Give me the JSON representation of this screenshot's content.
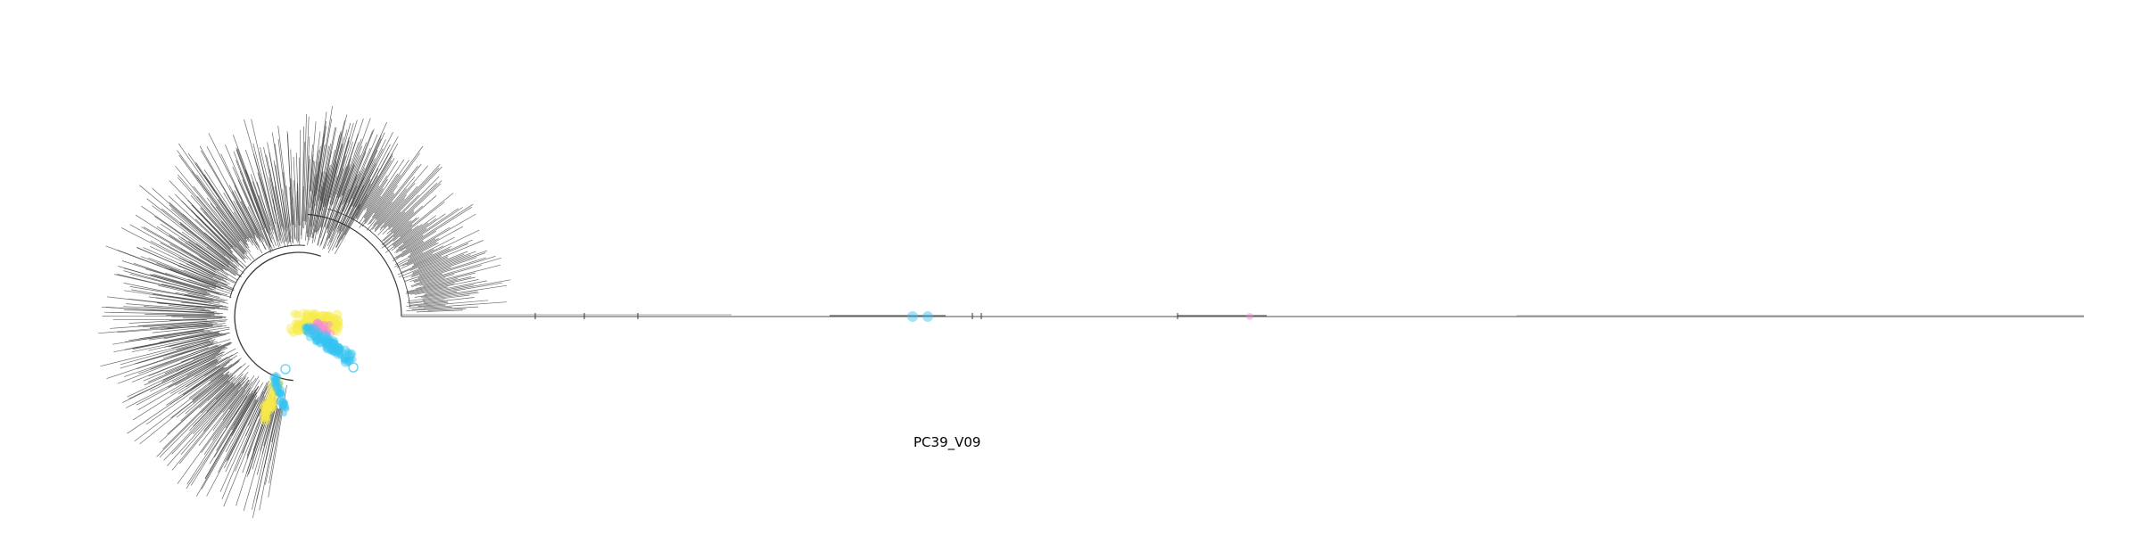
{
  "figure": {
    "caption": "PC39_V09",
    "colors": {
      "branch": "#3a3a3a",
      "long_branch": "#8a8a8a",
      "highlight_cyan": "#35c4f2",
      "highlight_yellow": "#f7ea4a",
      "highlight_pink": "#f58ad8"
    },
    "marker_groups": [
      "cyan",
      "yellow",
      "pink"
    ]
  }
}
